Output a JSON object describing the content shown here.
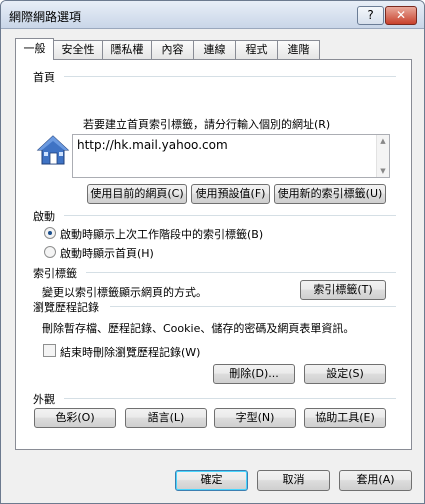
{
  "window": {
    "title": "網際網路選項",
    "help_label": "?",
    "close_label": "✕"
  },
  "tabs": [
    "一般",
    "安全性",
    "隱私權",
    "內容",
    "連線",
    "程式",
    "進階"
  ],
  "home": {
    "section_title": "首頁",
    "description": "若要建立首頁索引標籤，請分行輸入個別的網址(R)",
    "url_value": "http://hk.mail.yahoo.com",
    "use_current": "使用目前的網頁(C)",
    "use_default": "使用預設值(F)",
    "use_blank": "使用新的索引標籤(U)"
  },
  "startup": {
    "section_title": "啟動",
    "option1": "啟動時顯示上次工作階段中的索引標籤(B)",
    "option2": "啟動時顯示首頁(H)",
    "selected": 1
  },
  "tabs_section": {
    "section_title": "索引標籤",
    "description": "變更以索引標籤顯示網頁的方式。",
    "button": "索引標籤(T)"
  },
  "history": {
    "section_title": "瀏覽歷程記錄",
    "description": "刪除暫存檔、歷程記錄、Cookie、儲存的密碼及網頁表單資訊。",
    "checkbox_label": "結束時刪除瀏覽歷程記錄(W)",
    "checkbox_checked": false,
    "delete_button": "刪除(D)...",
    "settings_button": "設定(S)"
  },
  "appearance": {
    "section_title": "外觀",
    "colors": "色彩(O)",
    "languages": "語言(L)",
    "fonts": "字型(N)",
    "accessibility": "協助工具(E)"
  },
  "footer": {
    "ok": "確定",
    "cancel": "取消",
    "apply": "套用(A)"
  }
}
